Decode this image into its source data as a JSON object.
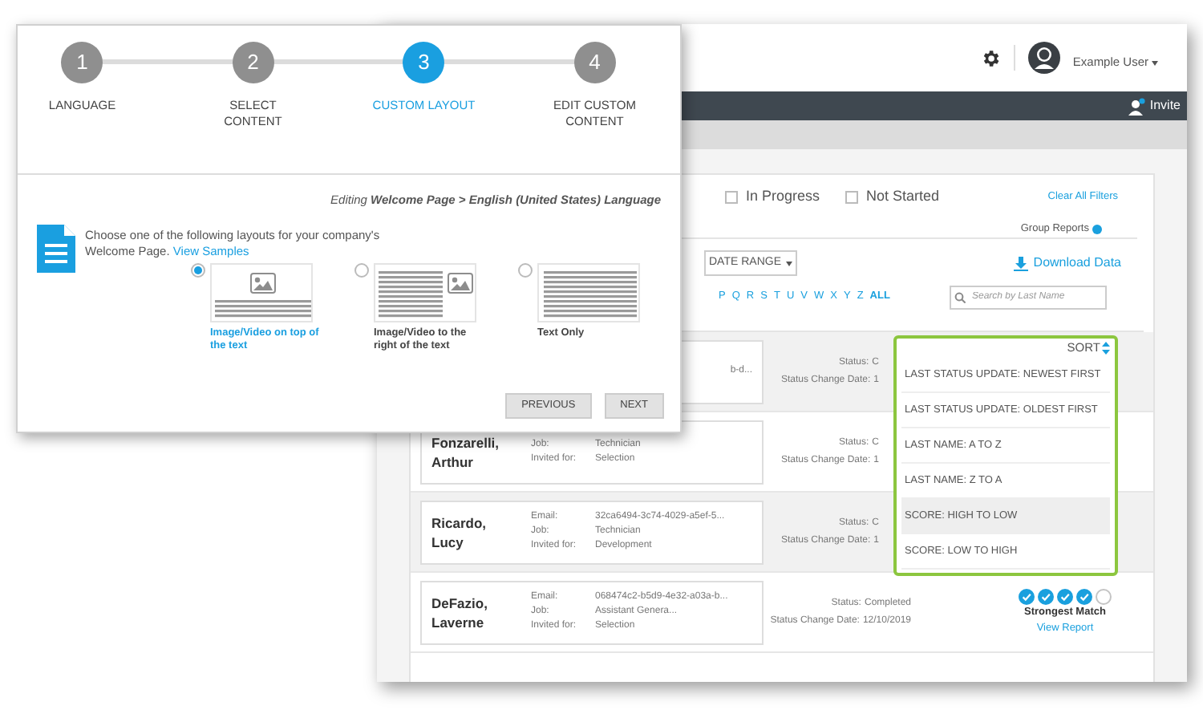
{
  "back_window": {
    "user": {
      "name": "Example User"
    },
    "nav": {
      "invite": "Invite"
    },
    "filters": [
      {
        "label": "In Progress",
        "checked": false
      },
      {
        "label": "Not Started",
        "checked": false
      }
    ],
    "clear_filters": "Clear All Filters",
    "group_reports": "Group Reports",
    "date_range": "DATE RANGE",
    "download": "Download Data",
    "letters": [
      {
        "label": "P",
        "selected": false
      },
      {
        "label": "Q",
        "selected": false
      },
      {
        "label": "R",
        "selected": false
      },
      {
        "label": "S",
        "selected": false
      },
      {
        "label": "T",
        "selected": false
      },
      {
        "label": "U",
        "selected": false
      },
      {
        "label": "V",
        "selected": false
      },
      {
        "label": "W",
        "selected": false
      },
      {
        "label": "X",
        "selected": false
      },
      {
        "label": "Y",
        "selected": false
      },
      {
        "label": "Z",
        "selected": false
      },
      {
        "label": "ALL",
        "selected": true
      }
    ],
    "search": {
      "placeholder": "Search by Last Name"
    },
    "sort": {
      "label": "SORT",
      "options": [
        {
          "label": "LAST STATUS UPDATE: NEWEST FIRST",
          "selected": false
        },
        {
          "label": "LAST STATUS UPDATE: OLDEST FIRST",
          "selected": false
        },
        {
          "label": "LAST NAME: A TO Z",
          "selected": false
        },
        {
          "label": "LAST NAME: Z TO A",
          "selected": false
        },
        {
          "label": "SCORE: HIGH TO LOW",
          "selected": true
        },
        {
          "label": "SCORE: LOW TO HIGH",
          "selected": false
        }
      ]
    },
    "rows": [
      {
        "name": [],
        "fields": [
          {
            "value": "b-d..."
          }
        ],
        "status_label": "Status:",
        "status": "C",
        "date_label": "Status Change Date:",
        "date": "1"
      },
      {
        "name": [
          "Fonzarelli,",
          "Arthur"
        ],
        "fields": [
          {
            "label": "Job:",
            "value": "Technician"
          },
          {
            "label": "Invited for:",
            "value": "Selection"
          }
        ],
        "status_label": "Status:",
        "status": "C",
        "date_label": "Status Change Date:",
        "date": "1"
      },
      {
        "name": [
          "Ricardo,",
          "Lucy"
        ],
        "fields": [
          {
            "label": "Email:",
            "value": "32ca6494-3c74-4029-a5ef-5..."
          },
          {
            "label": "Job:",
            "value": "Technician"
          },
          {
            "label": "Invited for:",
            "value": "Development"
          }
        ],
        "status_label": "Status:",
        "status": "C",
        "date_label": "Status Change Date:",
        "date": "1"
      },
      {
        "name": [
          "DeFazio,",
          "Laverne"
        ],
        "fields": [
          {
            "label": "Email:",
            "value": "068474c2-b5d9-4e32-a03a-b..."
          },
          {
            "label": "Job:",
            "value": "Assistant Genera..."
          },
          {
            "label": "Invited for:",
            "value": "Selection"
          }
        ],
        "status_label": "Status:",
        "status": "Completed",
        "date_label": "Status Change Date:",
        "date": "12/10/2019",
        "score": {
          "checks": [
            {
              "checked": true
            },
            {
              "checked": true
            },
            {
              "checked": true
            },
            {
              "checked": true
            },
            {
              "checked": false
            }
          ],
          "label": "Strongest Match",
          "link": "View Report"
        }
      }
    ]
  },
  "front_window": {
    "steps": [
      {
        "number": "1",
        "label": "LANGUAGE",
        "selected": false
      },
      {
        "number": "2",
        "label": "SELECT CONTENT",
        "selected": false
      },
      {
        "number": "3",
        "label": "CUSTOM LAYOUT",
        "selected": true
      },
      {
        "number": "4",
        "label": "EDIT CUSTOM CONTENT",
        "selected": false
      }
    ],
    "breadcrumb": "Editing **Welcome Page > English (United States) Language**",
    "intro": "Choose one of the following layouts for your company's Welcome Page.",
    "intro_link": "View Samples",
    "layouts": [
      {
        "kind": "image-top",
        "label": "Image/Video on top of the text",
        "selected": true
      },
      {
        "kind": "image-right",
        "label": "Image/Video to the right of the text",
        "selected": false
      },
      {
        "kind": "text-only",
        "label": "Text Only",
        "selected": false
      }
    ],
    "buttons": [
      "PREVIOUS",
      "NEXT"
    ]
  }
}
